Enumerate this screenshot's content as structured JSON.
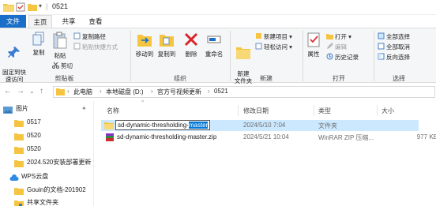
{
  "window": {
    "title": "0521"
  },
  "tabs": {
    "file": "文件",
    "home": "主页",
    "share": "共享",
    "view": "查看"
  },
  "ribbon": {
    "pin_quick": "固定到快\n速访问",
    "copy": "复制",
    "paste": "粘贴",
    "copy_path": "复制路径",
    "paste_shortcut": "粘贴快捷方式",
    "cut": "剪切",
    "clipboard_group": "剪贴板",
    "move_to": "移动到",
    "copy_to": "复制到",
    "delete": "删除",
    "rename": "重命名",
    "organize_group": "组织",
    "new_item": "新建项目",
    "easy_access": "轻松访问",
    "new_folder": "新建\n文件夹",
    "new_group": "新建",
    "properties": "属性",
    "open": "打开",
    "edit": "编辑",
    "history": "历史记录",
    "open_group": "打开",
    "select_all": "全部选择",
    "select_none": "全部取消",
    "invert": "反向选择",
    "select_group": "选择"
  },
  "address": {
    "crumbs": [
      "此电脑",
      "本地磁盘 (D:)",
      "官方号视频更新",
      "0521"
    ]
  },
  "nav": {
    "items": [
      {
        "label": "图片",
        "icon": "pictures-icon"
      },
      {
        "label": "0517",
        "icon": "folder-icon"
      },
      {
        "label": "0520",
        "icon": "folder-icon"
      },
      {
        "label": "0520",
        "icon": "folder-icon"
      },
      {
        "label": "2024.520安装部署更新",
        "icon": "folder-icon"
      },
      {
        "label": "WPS云盘",
        "icon": "cloud-icon"
      },
      {
        "label": "Gouin的文档-201902",
        "icon": "folder-icon"
      },
      {
        "label": "共享文件夹",
        "icon": "shared-folder-icon"
      }
    ]
  },
  "columns": {
    "name": "名称",
    "date": "修改日期",
    "type": "类型",
    "size": "大小"
  },
  "files": [
    {
      "name_plain": "sd-dynamic-thresholding-",
      "name_highlight": "master",
      "date": "2024/5/10 7:04",
      "type": "文件夹",
      "size": ""
    },
    {
      "name": "sd-dynamic-thresholding-master.zip",
      "date": "2024/5/21 10:04",
      "type": "WinRAR ZIP 压缩...",
      "size": "977 KB"
    }
  ],
  "colors": {
    "accent": "#1a6fc9",
    "selection": "#cce8ff",
    "folder": "#f5c542"
  }
}
